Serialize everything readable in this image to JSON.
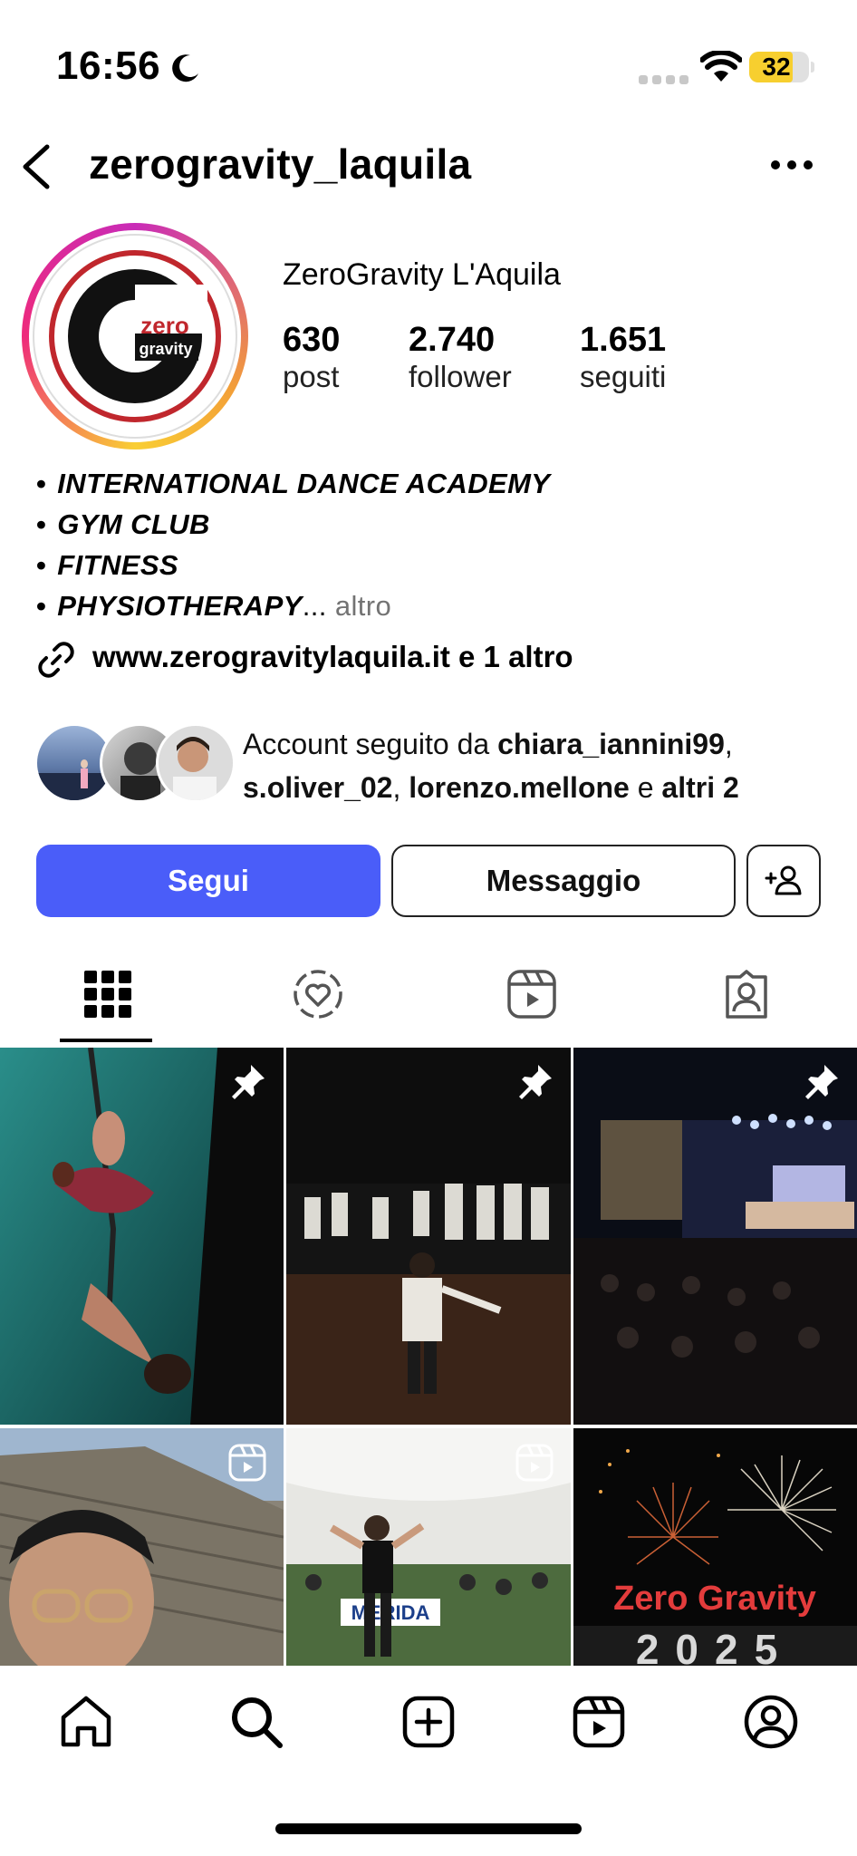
{
  "status_bar": {
    "time": "16:56",
    "battery": "32"
  },
  "header": {
    "username": "zerogravity_laquila"
  },
  "profile": {
    "display_name": "ZeroGravity L'Aquila",
    "stats": [
      {
        "value": "630",
        "label": "post"
      },
      {
        "value": "2.740",
        "label": "follower"
      },
      {
        "value": "1.651",
        "label": "seguiti"
      }
    ],
    "avatar_text": {
      "zero": "zero",
      "gravity": "gravity"
    }
  },
  "bio": {
    "lines": [
      "INTERNATIONAL DANCE ACADEMY",
      "GYM CLUB",
      "FITNESS",
      "PHYSIOTHERAPY"
    ],
    "ellipsis": "...",
    "more_label": "altro",
    "link": "www.zerogravitylaquila.it e 1 altro"
  },
  "followed_by": {
    "prefix": "Account seguito da ",
    "user1": "chiara_iannini99",
    "sep1": ",",
    "user2": "s.oliver_02",
    "sep2": ", ",
    "user3": "lorenzo.mellone",
    "conj": " e ",
    "others": "altri 2"
  },
  "actions": {
    "follow": "Segui",
    "message": "Messaggio"
  },
  "grid": {
    "tile6_text": "Zero Gravity",
    "tile6_year": "2025",
    "tile5_text": "MERIDA"
  },
  "colors": {
    "primary_button": "#4a5df9",
    "gradient_ring": [
      "#c92bb7",
      "#f3a037",
      "#f9ce34",
      "#ee2a7b"
    ]
  }
}
